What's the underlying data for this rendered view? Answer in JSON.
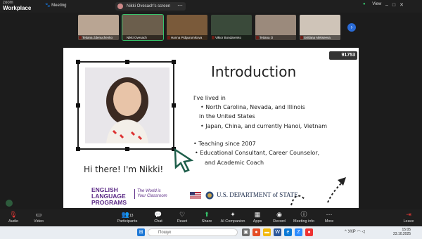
{
  "app": {
    "brand_top": "zoom",
    "brand_bottom": "Workplace",
    "meeting_label": "Meeting",
    "share_tab": "Nikki Ovesach's screen",
    "view_label": "View"
  },
  "participants": [
    {
      "name": "Tetiana Zdenuchenko"
    },
    {
      "name": "Nikki Ovesach"
    },
    {
      "name": "Hanna Pidgurumikova"
    },
    {
      "name": "Viktor Bondarenko"
    },
    {
      "name": "Tetiana O"
    },
    {
      "name": "Svitlana Alekseeva"
    }
  ],
  "slide": {
    "meeting_id": "91753",
    "title": "Introduction",
    "greeting": "Hi there! I'm Nikki!",
    "lines": [
      "I've lived in",
      "•   North Carolina, Nevada, and Illinois",
      "in the United States",
      "•   Japan, China, and currently Hanoi, Vietnam",
      "•   Teaching since 2007",
      "•   Educational Consultant, Career Counselor,",
      "and Academic Coach"
    ],
    "logo_line1": "ENGLISH",
    "logo_line2": "LANGUAGE",
    "logo_line3": "PROGRAMS",
    "logo_tag1": "The World is",
    "logo_tag2": "Your Classroom",
    "dos": "U.S. DEPARTMENT of STATE"
  },
  "toolbar": {
    "audio": "Audio",
    "video": "Video",
    "participants": "Participants",
    "participants_count": "13",
    "chat": "Chat",
    "react": "React",
    "share": "Share",
    "ai": "AI Companion",
    "apps": "Apps",
    "record": "Record",
    "meeting_info": "Meeting info",
    "more": "More",
    "leave": "Leave"
  },
  "taskbar": {
    "search_placeholder": "Пошук",
    "lang": "УКР",
    "time": "15:05",
    "date": "23.10.2025"
  },
  "colors": {
    "active_border": "#35c46b",
    "leave": "#e53935",
    "elp_purple": "#5b2a86"
  }
}
